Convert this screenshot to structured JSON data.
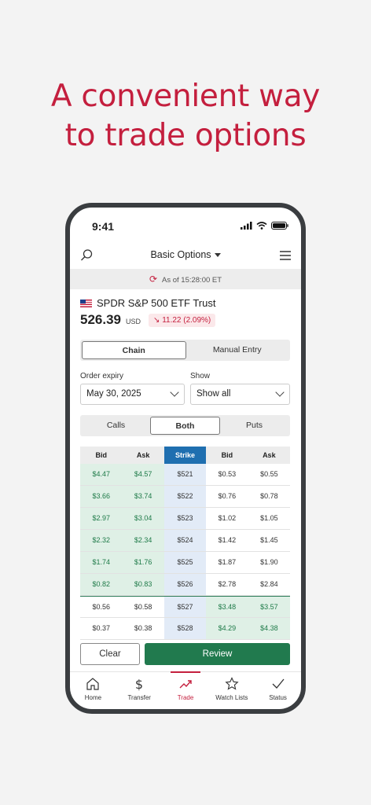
{
  "headline": {
    "line1": "A convenient way",
    "line2": "to trade options"
  },
  "status": {
    "time": "9:41"
  },
  "appbar": {
    "title": "Basic Options"
  },
  "asof": {
    "text": "As of 15:28:00 ET"
  },
  "security": {
    "name": "SPDR S&P 500 ETF Trust",
    "price": "526.39",
    "currency": "USD",
    "change": "11.22 (2.09%)",
    "change_color": "#c41f3e"
  },
  "entry_tabs": {
    "chain": "Chain",
    "manual": "Manual Entry",
    "selected": "Chain"
  },
  "filters": {
    "expiry_label": "Order expiry",
    "expiry_value": "May 30, 2025",
    "show_label": "Show",
    "show_value": "Show all"
  },
  "type_tabs": {
    "calls": "Calls",
    "both": "Both",
    "puts": "Puts",
    "selected": "Both"
  },
  "table": {
    "headers": [
      "Bid",
      "Ask",
      "Strike",
      "Bid",
      "Ask"
    ],
    "rows": [
      [
        "$4.47",
        "$4.57",
        "$521",
        "$0.53",
        "$0.55"
      ],
      [
        "$3.66",
        "$3.74",
        "$522",
        "$0.76",
        "$0.78"
      ],
      [
        "$2.97",
        "$3.04",
        "$523",
        "$1.02",
        "$1.05"
      ],
      [
        "$2.32",
        "$2.34",
        "$524",
        "$1.42",
        "$1.45"
      ],
      [
        "$1.74",
        "$1.76",
        "$525",
        "$1.87",
        "$1.90"
      ],
      [
        "$0.82",
        "$0.83",
        "$526",
        "$2.78",
        "$2.84"
      ],
      [
        "$0.56",
        "$0.58",
        "$527",
        "$3.48",
        "$3.57"
      ],
      [
        "$0.37",
        "$0.38",
        "$528",
        "$4.29",
        "$4.38"
      ]
    ]
  },
  "buttons": {
    "clear": "Clear",
    "review": "Review"
  },
  "tabbar": {
    "items": [
      {
        "label": "Home",
        "icon": "home-icon"
      },
      {
        "label": "Transfer",
        "icon": "dollar-icon"
      },
      {
        "label": "Trade",
        "icon": "trend-icon"
      },
      {
        "label": "Watch Lists",
        "icon": "star-icon"
      },
      {
        "label": "Status",
        "icon": "check-icon"
      }
    ],
    "active": "Trade"
  },
  "colors": {
    "brand": "#c41f3e",
    "green": "#217a4e",
    "strike_header": "#1f6fb0"
  }
}
